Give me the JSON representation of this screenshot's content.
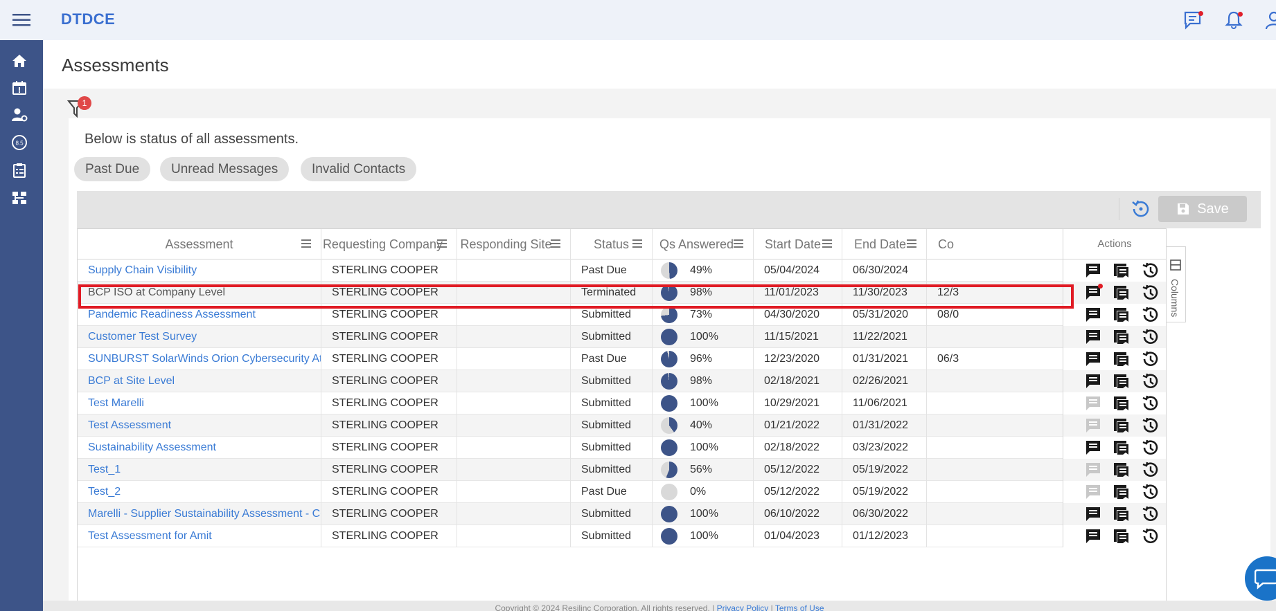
{
  "app": {
    "brand": "DTDCE"
  },
  "page": {
    "title": "Assessments"
  },
  "filter": {
    "badge_count": "1"
  },
  "intro": "Below is status of all assessments.",
  "chips": [
    "Past Due",
    "Unread Messages",
    "Invalid Contacts"
  ],
  "toolbar": {
    "save_label": "Save"
  },
  "columns": {
    "assessment": "Assessment",
    "requesting_company": "Requesting Company",
    "responding_site": "Responding Site",
    "status": "Status",
    "qs_answered": "Qs Answered",
    "start_date": "Start Date",
    "end_date": "End Date",
    "completed": "Co",
    "actions": "Actions"
  },
  "columns_tab_label": "Columns",
  "rows": [
    {
      "assessment": "Supply Chain Visibility",
      "company": "STERLING COOPER",
      "site": "",
      "status": "Past Due",
      "qs": "49%",
      "qs_fraction": 0.49,
      "start": "05/04/2024",
      "end": "06/30/2024",
      "extra": "",
      "link": true,
      "msg_active": true
    },
    {
      "assessment": "BCP ISO at Company Level",
      "company": "STERLING COOPER",
      "site": "",
      "status": "Terminated",
      "qs": "98%",
      "qs_fraction": 0.98,
      "start": "11/01/2023",
      "end": "11/30/2023",
      "extra": "12/3",
      "link": false,
      "msg_active": true
    },
    {
      "assessment": "Pandemic Readiness Assessment",
      "company": "STERLING COOPER",
      "site": "",
      "status": "Submitted",
      "qs": "73%",
      "qs_fraction": 0.73,
      "start": "04/30/2020",
      "end": "05/31/2020",
      "extra": "08/0",
      "link": true,
      "msg_active": true
    },
    {
      "assessment": "Customer Test Survey",
      "company": "STERLING COOPER",
      "site": "",
      "status": "Submitted",
      "qs": "100%",
      "qs_fraction": 1.0,
      "start": "11/15/2021",
      "end": "11/22/2021",
      "extra": "",
      "link": true,
      "msg_active": true
    },
    {
      "assessment": "SUNBURST SolarWinds Orion Cybersecurity Attack",
      "company": "STERLING COOPER",
      "site": "",
      "status": "Past Due",
      "qs": "96%",
      "qs_fraction": 0.96,
      "start": "12/23/2020",
      "end": "01/31/2021",
      "extra": "06/3",
      "link": true,
      "msg_active": true
    },
    {
      "assessment": "BCP at Site Level",
      "company": "STERLING COOPER",
      "site": "",
      "status": "Submitted",
      "qs": "98%",
      "qs_fraction": 0.98,
      "start": "02/18/2021",
      "end": "02/26/2021",
      "extra": "",
      "link": true,
      "msg_active": true
    },
    {
      "assessment": "Test Marelli",
      "company": "STERLING COOPER",
      "site": "",
      "status": "Submitted",
      "qs": "100%",
      "qs_fraction": 1.0,
      "start": "10/29/2021",
      "end": "11/06/2021",
      "extra": "",
      "link": true,
      "msg_active": false
    },
    {
      "assessment": "Test Assessment",
      "company": "STERLING COOPER",
      "site": "",
      "status": "Submitted",
      "qs": "40%",
      "qs_fraction": 0.4,
      "start": "01/21/2022",
      "end": "01/31/2022",
      "extra": "",
      "link": true,
      "msg_active": false
    },
    {
      "assessment": "Sustainability Assessment",
      "company": "STERLING COOPER",
      "site": "",
      "status": "Submitted",
      "qs": "100%",
      "qs_fraction": 1.0,
      "start": "02/18/2022",
      "end": "03/23/2022",
      "extra": "",
      "link": true,
      "msg_active": true
    },
    {
      "assessment": "Test_1",
      "company": "STERLING COOPER",
      "site": "",
      "status": "Submitted",
      "qs": "56%",
      "qs_fraction": 0.56,
      "start": "05/12/2022",
      "end": "05/19/2022",
      "extra": "",
      "link": true,
      "msg_active": false
    },
    {
      "assessment": "Test_2",
      "company": "STERLING COOPER",
      "site": "",
      "status": "Past Due",
      "qs": "0%",
      "qs_fraction": 0.0,
      "start": "05/12/2022",
      "end": "05/19/2022",
      "extra": "",
      "link": true,
      "msg_active": false
    },
    {
      "assessment": "Marelli - Supplier Sustainability Assessment - Copy",
      "company": "STERLING COOPER",
      "site": "",
      "status": "Submitted",
      "qs": "100%",
      "qs_fraction": 1.0,
      "start": "06/10/2022",
      "end": "06/30/2022",
      "extra": "",
      "link": true,
      "msg_active": true
    },
    {
      "assessment": "Test Assessment for Amit",
      "company": "STERLING COOPER",
      "site": "",
      "status": "Submitted",
      "qs": "100%",
      "qs_fraction": 1.0,
      "start": "01/04/2023",
      "end": "01/12/2023",
      "extra": "",
      "link": true,
      "msg_active": true
    }
  ],
  "footer": {
    "copyright": "Copyright © 2024 Resilinc Corporation. All rights reserved. | ",
    "privacy": "Privacy Policy",
    "sep": " | ",
    "terms": "Terms of Use"
  },
  "colors": {
    "sidebar": "#3d5488",
    "accent": "#3a7bd5",
    "pie_fill": "#3d5488",
    "pie_empty": "#d9d9d9",
    "highlight": "#e01b24"
  }
}
